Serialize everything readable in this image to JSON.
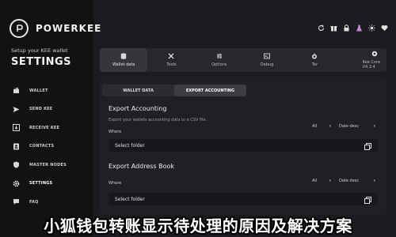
{
  "brand": {
    "name": "POWERKEE",
    "subtitle": "Setup your KEE wallet"
  },
  "page": {
    "heading": "SETTINGS"
  },
  "sidebar": {
    "items": [
      {
        "label": "WALLET",
        "icon": "wallet-icon"
      },
      {
        "label": "SEND KEE",
        "icon": "send-icon"
      },
      {
        "label": "RECEIVE KEE",
        "icon": "receive-icon"
      },
      {
        "label": "CONTACTS",
        "icon": "contacts-icon"
      },
      {
        "label": "MASTER NODES",
        "icon": "masternodes-icon"
      },
      {
        "label": "SETTINGS",
        "icon": "settings-icon",
        "active": true
      },
      {
        "label": "FAQ",
        "icon": "faq-icon"
      }
    ]
  },
  "toolbar_icons": [
    "refresh-icon",
    "gift-icon",
    "lock-icon",
    "flask-icon",
    "sun-icon",
    "heart-icon"
  ],
  "tabs": [
    {
      "label": "Wallet data",
      "icon": "database-icon",
      "active": true
    },
    {
      "label": "Tools",
      "icon": "tools-icon"
    },
    {
      "label": "Options",
      "icon": "options-icon"
    },
    {
      "label": "Debug",
      "icon": "debug-icon"
    },
    {
      "label": "Tor",
      "icon": "tor-icon"
    },
    {
      "label": "Kee Core V4.3.4",
      "icon": "core-icon"
    }
  ],
  "segment": {
    "wallet_data": "WALLET DATA",
    "export_accounting": "EXPORT ACCOUNTING"
  },
  "export_accounting": {
    "title": "Export Accounting",
    "description": "Export your wallets accounting data to a CSV file.",
    "where_label": "Where",
    "filter_all": "All",
    "filter_sort": "Date desc",
    "folder_placeholder": "Select folder"
  },
  "export_address_book": {
    "title": "Export Address Book",
    "where_label": "Where",
    "filter_all": "All",
    "filter_sort": "Date desc",
    "folder_placeholder": "Select folder"
  },
  "banner": {
    "text": "小狐钱包转账显示待处理的原因及解决方案"
  },
  "colors": {
    "background": "#1b1c1f",
    "sidebar": "#111214",
    "panel": "#1f2023",
    "tabbar": "#26282c",
    "accent": "#ffffff"
  }
}
